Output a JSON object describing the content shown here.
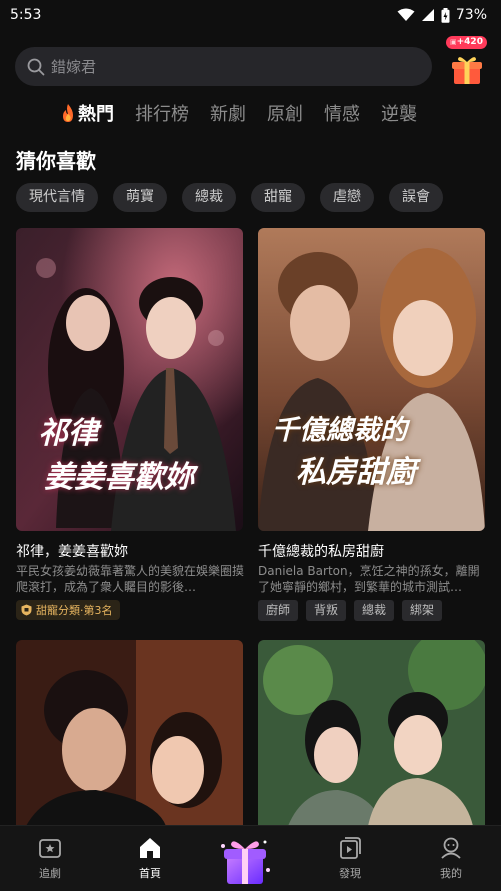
{
  "status": {
    "time": "5:53",
    "battery": "73%"
  },
  "search": {
    "placeholder": "錯嫁君"
  },
  "gift": {
    "badge": "+420"
  },
  "tabs": [
    {
      "label": "熱門",
      "active": true
    },
    {
      "label": "排行榜"
    },
    {
      "label": "新劇"
    },
    {
      "label": "原創"
    },
    {
      "label": "情感"
    },
    {
      "label": "逆襲"
    }
  ],
  "section": {
    "title": "猜你喜歡"
  },
  "chips": [
    "現代言情",
    "萌寶",
    "總裁",
    "甜寵",
    "虐戀",
    "誤會"
  ],
  "cards": [
    {
      "title": "祁律，姜姜喜歡妳",
      "desc": "平民女孩姜幼薇靠著驚人的美貌在娛樂圈摸爬滾打，成為了衆人矚目的影後…",
      "poster_calligraphy": [
        "祁律",
        "姜姜喜歡妳"
      ],
      "rank_badge": "甜寵分類·第3名"
    },
    {
      "title": "千億總裁的私房甜廚",
      "desc": "Daniela Barton，烹饪之神的孫女，離開了她寧靜的鄉村，到繁華的城市測試…",
      "poster_calligraphy": [
        "千億總裁的",
        "私房甜廚"
      ],
      "tags": [
        "廚師",
        "背叛",
        "總裁",
        "綁架"
      ]
    },
    {
      "title": "",
      "desc": ""
    },
    {
      "title": "",
      "desc": ""
    }
  ],
  "nav": {
    "follow": "追劇",
    "home": "首頁",
    "discover": "發現",
    "me": "我的"
  },
  "colors": {
    "accent": "#ff3a5a",
    "gold": "#e7b560",
    "bg": "#0f0f0f"
  }
}
